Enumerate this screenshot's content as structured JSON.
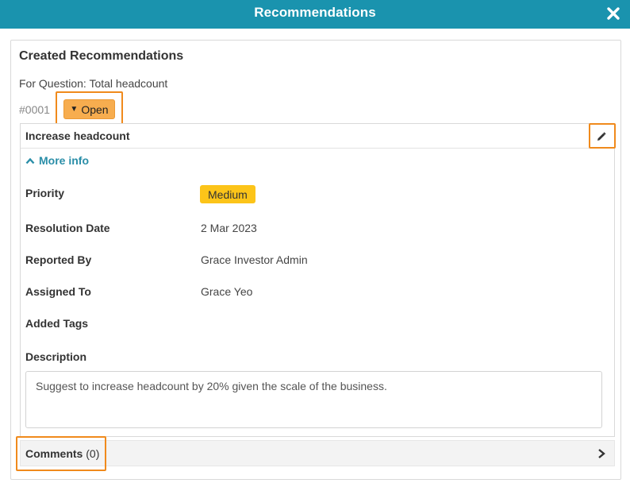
{
  "modal": {
    "title": "Recommendations",
    "close_icon": "close-icon"
  },
  "panel": {
    "title": "Created Recommendations",
    "question_line": "For Question: Total headcount"
  },
  "recommendation": {
    "number": "#0001",
    "status": "Open",
    "title": "Increase headcount",
    "more_info_label": "More info",
    "fields": {
      "priority_label": "Priority",
      "priority_value": "Medium",
      "resolution_date_label": "Resolution Date",
      "resolution_date_value": "2 Mar 2023",
      "reported_by_label": "Reported By",
      "reported_by_value": "Grace Investor Admin",
      "assigned_to_label": "Assigned To",
      "assigned_to_value": "Grace Yeo",
      "added_tags_label": "Added Tags",
      "description_label": "Description",
      "description_value": "Suggest to increase headcount by 20% given the scale of the business."
    }
  },
  "comments": {
    "label": "Comments",
    "count": "(0)"
  },
  "colors": {
    "header": "#1a93ae",
    "status": "#f7ad4f",
    "priority": "#fcc419",
    "highlight": "#f08a1c",
    "link": "#2a8ea8"
  },
  "icons": [
    "close-icon",
    "caret-down-icon",
    "pencil-icon",
    "chevron-up-icon",
    "chevron-right-icon"
  ]
}
